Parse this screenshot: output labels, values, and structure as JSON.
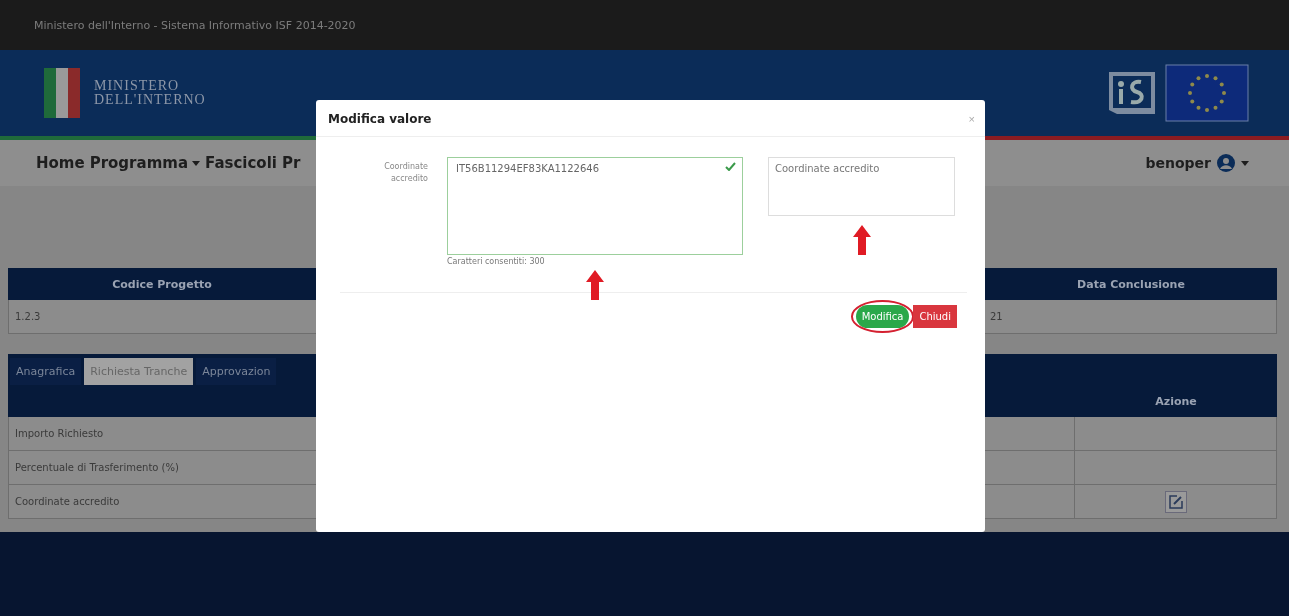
{
  "top_bar": {
    "title": "Ministero dell'Interno - Sistema Informativo ISF 2014-2020"
  },
  "header": {
    "logo_lines": [
      "MINISTERO",
      "DELL'INTERNO"
    ]
  },
  "nav": {
    "items": [
      {
        "label": "Home",
        "dropdown": false
      },
      {
        "label": "Programma",
        "dropdown": true
      },
      {
        "label": "Fascicoli",
        "dropdown": false
      },
      {
        "label": "Pr",
        "dropdown": false
      }
    ],
    "user": "benoper"
  },
  "project_table": {
    "columns": [
      "Codice Progetto",
      "Data Conclusione"
    ],
    "rows": [
      [
        "1.2.3",
        "21"
      ]
    ]
  },
  "tabs": [
    {
      "label": "Anagrafica",
      "selected": false
    },
    {
      "label": "Richiesta Tranche",
      "selected": true
    },
    {
      "label": "Approvazion",
      "selected": false
    }
  ],
  "detail_table": {
    "columns": [
      "Azione"
    ],
    "rows": [
      {
        "label": "Importo Richiesto",
        "editable": false
      },
      {
        "label": "Percentuale di Trasferimento (%)",
        "editable": false
      },
      {
        "label": "Coordinate accredito",
        "editable": true
      }
    ]
  },
  "modal": {
    "title": "Modifica valore",
    "close": "×",
    "field_label": "Coordinate accredito",
    "value": "IT56B11294EF83KA1122646",
    "valid": true,
    "hint": "Caratteri consentiti: 300",
    "note_placeholder": "Coordinate accredito",
    "buttons": [
      {
        "label": "Modifica",
        "kind": "primary",
        "highlighted": true
      },
      {
        "label": "Chiudi",
        "kind": "danger",
        "highlighted": false
      }
    ]
  }
}
